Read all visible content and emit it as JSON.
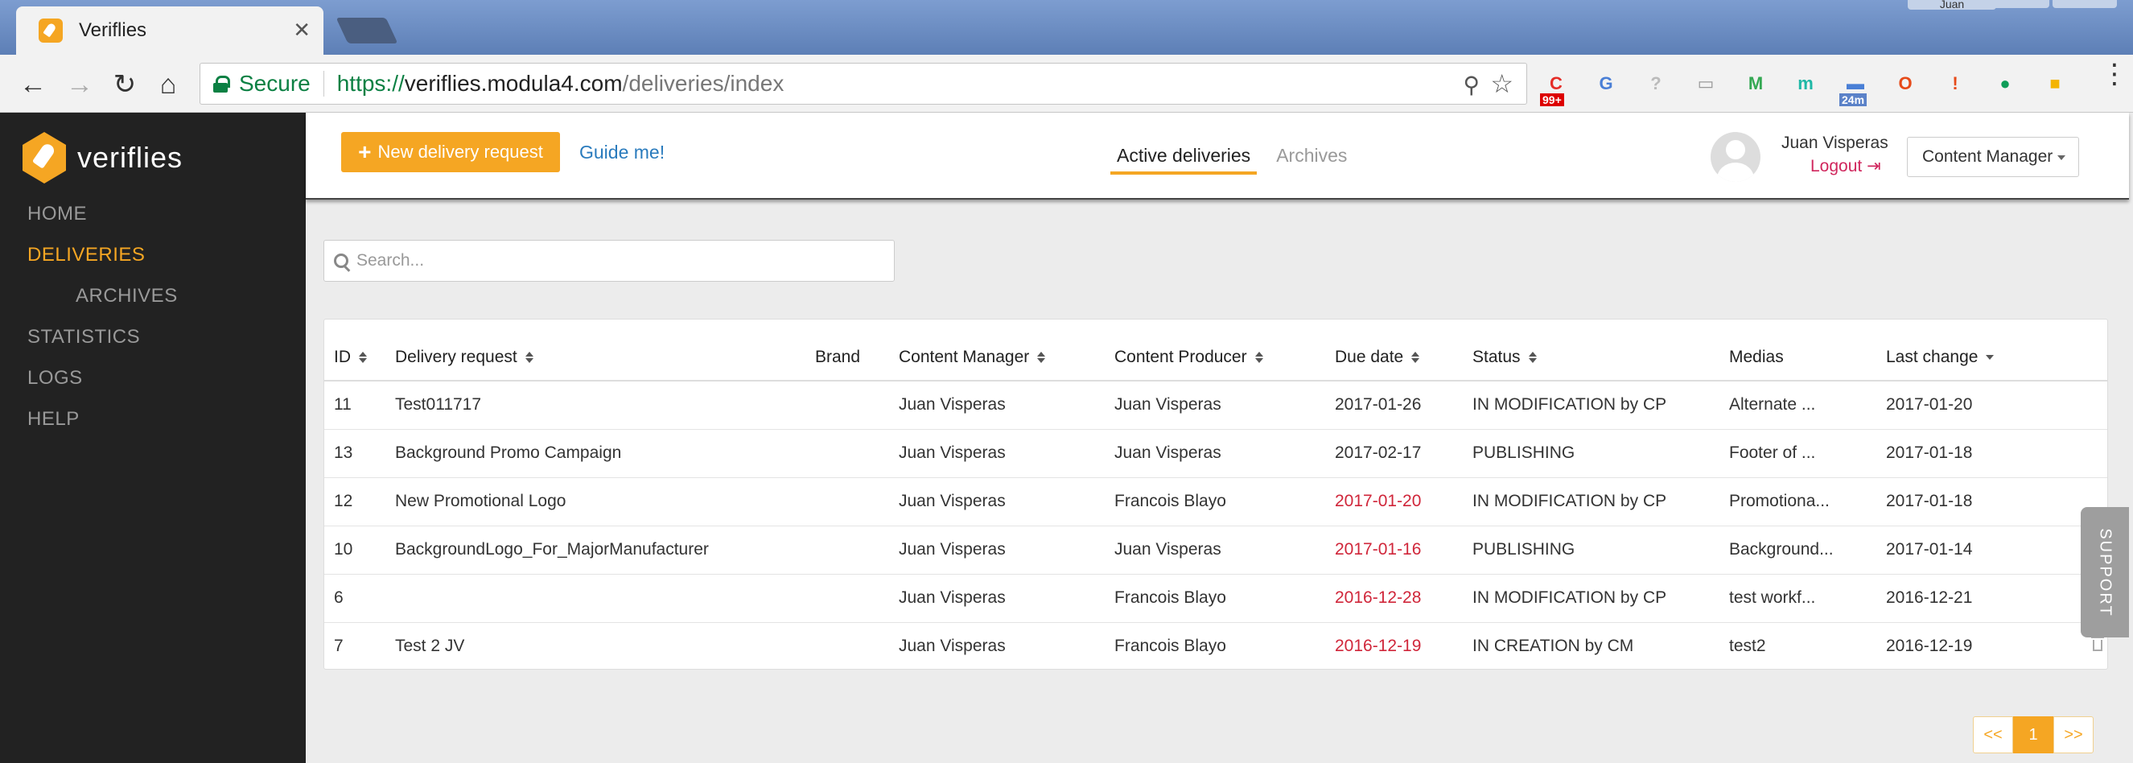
{
  "browser": {
    "tab_title": "Veriflies",
    "tab_close": "✕",
    "user_chip": "Juan",
    "secure_label": "Secure",
    "url_scheme": "https://",
    "url_host": "veriflies.modula4.com",
    "url_path": "/deliveries/index",
    "extensions": [
      {
        "name": "c-ext",
        "glyph": "C",
        "color": "#e52d27",
        "badge": "99+"
      },
      {
        "name": "translate-ext",
        "glyph": "G",
        "color": "#4a7fd6",
        "badge": ""
      },
      {
        "name": "help-ext",
        "glyph": "?",
        "color": "#bbbbbb",
        "badge": ""
      },
      {
        "name": "cast-ext",
        "glyph": "▭",
        "color": "#999999",
        "badge": ""
      },
      {
        "name": "m-ext",
        "glyph": "M",
        "color": "#34a853",
        "badge": ""
      },
      {
        "name": "circle-ext",
        "glyph": "m",
        "color": "#1fb8a6",
        "badge": ""
      },
      {
        "name": "calendar-ext",
        "glyph": "▬",
        "color": "#4a7fd6",
        "badge": "24m"
      },
      {
        "name": "office-ext",
        "glyph": "O",
        "color": "#e64a19",
        "badge": ""
      },
      {
        "name": "alert-ext",
        "glyph": "!",
        "color": "#e64a19",
        "badge": ""
      },
      {
        "name": "hangouts-ext",
        "glyph": "●",
        "color": "#0f9d58",
        "badge": ""
      },
      {
        "name": "chat-ext",
        "glyph": "■",
        "color": "#f4b400",
        "badge": ""
      }
    ]
  },
  "brand": {
    "name": "veriflies"
  },
  "sidebar": {
    "items": [
      {
        "label": "HOME"
      },
      {
        "label": "DELIVERIES"
      },
      {
        "label": "ARCHIVES"
      },
      {
        "label": "STATISTICS"
      },
      {
        "label": "LOGS"
      },
      {
        "label": "HELP"
      }
    ]
  },
  "topbar": {
    "new_button": "New delivery request",
    "guide_link": "Guide me!",
    "tab_active": "Active deliveries",
    "tab_archives": "Archives",
    "user_name": "Juan Visperas",
    "logout": "Logout",
    "role": "Content Manager"
  },
  "search": {
    "placeholder": "Search..."
  },
  "table": {
    "headers": {
      "id": "ID",
      "request": "Delivery request",
      "brand": "Brand",
      "cm": "Content Manager",
      "cp": "Content Producer",
      "due": "Due date",
      "status": "Status",
      "medias": "Medias",
      "last": "Last change"
    },
    "rows": [
      {
        "id": "11",
        "request": "Test011717",
        "brand": "",
        "cm": "Juan Visperas",
        "cp": "Juan Visperas",
        "due": "2017-01-26",
        "status": "IN MODIFICATION by CP",
        "medias": "Alternate ...",
        "last": "2017-01-20"
      },
      {
        "id": "13",
        "request": "Background Promo Campaign",
        "brand": "",
        "cm": "Juan Visperas",
        "cp": "Juan Visperas",
        "due": "2017-02-17",
        "status": "PUBLISHING",
        "medias": "Footer of ...",
        "last": "2017-01-18"
      },
      {
        "id": "12",
        "request": "New Promotional Logo",
        "brand": "",
        "cm": "Juan Visperas",
        "cp": "Francois Blayo",
        "due": "2017-01-20",
        "status": "IN MODIFICATION by CP",
        "medias": "Promotiona...",
        "last": "2017-01-18"
      },
      {
        "id": "10",
        "request": "BackgroundLogo_For_MajorManufacturer",
        "brand": "",
        "cm": "Juan Visperas",
        "cp": "Juan Visperas",
        "due": "2017-01-16",
        "status": "PUBLISHING",
        "medias": "Background...",
        "last": "2017-01-14"
      },
      {
        "id": "6",
        "request": "",
        "brand": "",
        "cm": "Juan Visperas",
        "cp": "Francois Blayo",
        "due": "2016-12-28",
        "status": "IN MODIFICATION by CP",
        "medias": "test workf...",
        "last": "2016-12-21"
      },
      {
        "id": "7",
        "request": "Test 2 JV",
        "brand": "",
        "cm": "Juan Visperas",
        "cp": "Francois Blayo",
        "due": "2016-12-19",
        "status": "IN CREATION by CM",
        "medias": "test2",
        "last": "2016-12-19"
      }
    ],
    "overdue_color": "#d0263a"
  },
  "support": {
    "label": "SUPPORT"
  },
  "pager": {
    "prev": "<<",
    "current": "1",
    "next": ">>"
  },
  "colors": {
    "accent": "#f5a623",
    "sidebar_bg": "#222222",
    "link": "#2a7bbd",
    "logout": "#d0265d"
  }
}
